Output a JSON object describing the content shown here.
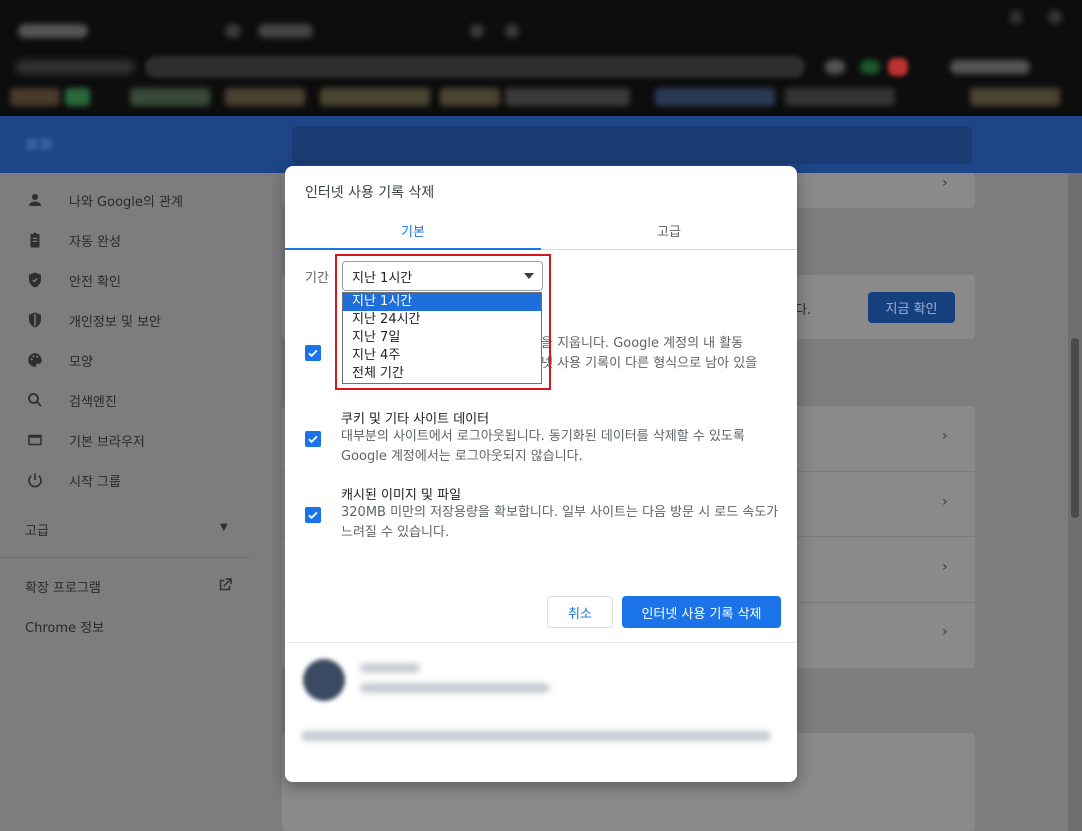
{
  "dialog": {
    "title": "인터넷 사용 기록 삭제",
    "tabs": [
      {
        "label": "기본",
        "active": true
      },
      {
        "label": "고급",
        "active": false
      }
    ],
    "time_range": {
      "label": "기간",
      "selected": "지난 1시간",
      "options": [
        "지난 1시간",
        "지난 24시간",
        "지난 7일",
        "지난 4주",
        "전체 기간"
      ]
    },
    "items": [
      {
        "checked": true,
        "partial_line1": "을 지웁니다. Google 계정의 내 활동",
        "partial_line2": "넷 사용 기록이 다른 형식으로 남아 있을"
      },
      {
        "checked": true,
        "title": "쿠키 및 기타 사이트 데이터",
        "description": "대부분의 사이트에서 로그아웃됩니다. 동기화된 데이터를 삭제할 수 있도록 Google 계정에서는 로그아웃되지 않습니다."
      },
      {
        "checked": true,
        "title": "캐시된 이미지 및 파일",
        "description": "320MB 미만의 저장용량을 확보합니다. 일부 사이트는 다음 방문 시 로드 속도가 느려질 수 있습니다."
      }
    ],
    "buttons": {
      "cancel": "취소",
      "confirm": "인터넷 사용 기록 삭제"
    }
  },
  "sidebar": {
    "items": [
      {
        "label": "나와 Google의 관계",
        "icon": "person-icon"
      },
      {
        "label": "자동 완성",
        "icon": "clipboard-icon"
      },
      {
        "label": "안전 확인",
        "icon": "shield-check-icon"
      },
      {
        "label": "개인정보 및 보안",
        "icon": "shield-icon"
      },
      {
        "label": "모양",
        "icon": "palette-icon"
      },
      {
        "label": "검색엔진",
        "icon": "search-icon"
      },
      {
        "label": "기본 브라우저",
        "icon": "browser-icon"
      },
      {
        "label": "시작 그룹",
        "icon": "power-icon"
      }
    ],
    "advanced": "고급",
    "extensions": "확장 프로그램",
    "about": "Chrome 정보"
  },
  "page": {
    "check_now_button": "지금 확인",
    "safety_text_fragment": "다."
  },
  "colors": {
    "accent": "#1a73e8",
    "highlight_border": "#d6171f",
    "header_bg": "#1d4587"
  }
}
